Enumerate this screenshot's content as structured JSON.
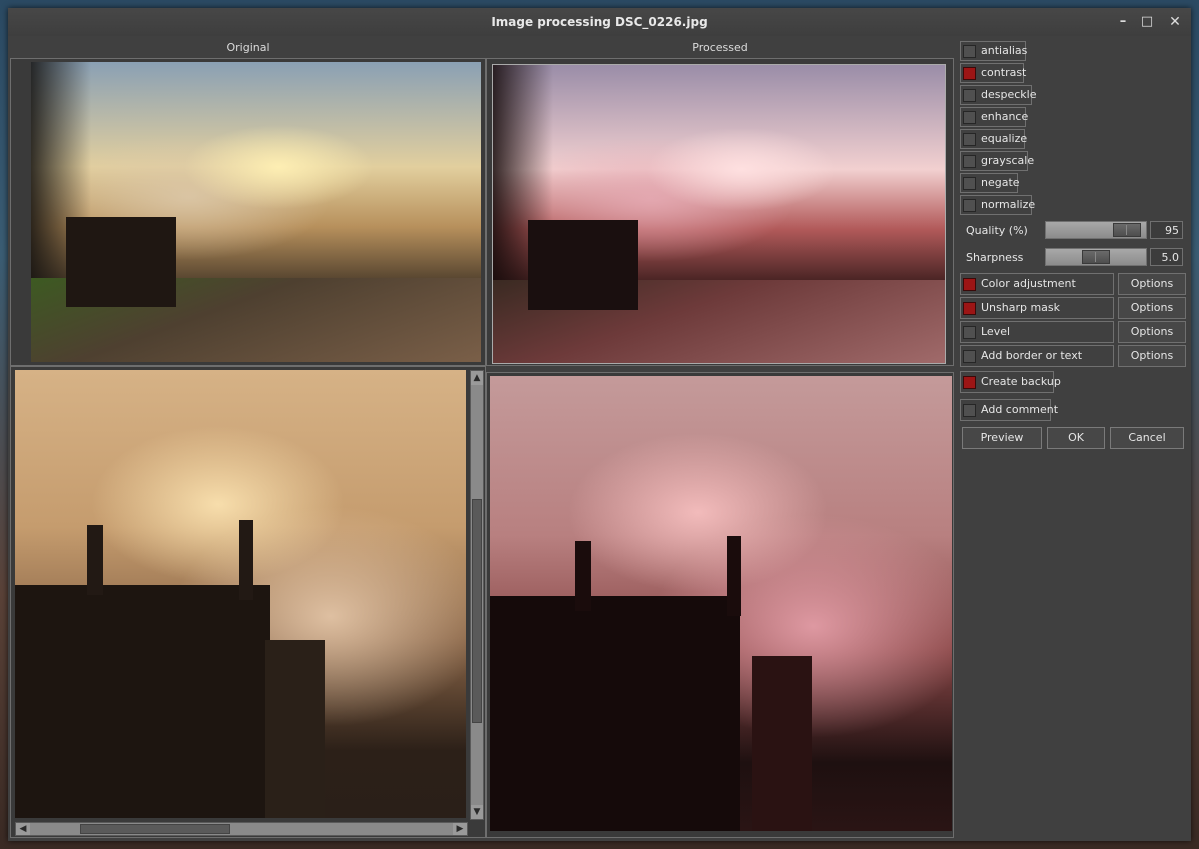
{
  "window": {
    "title": "Image processing DSC_0226.jpg"
  },
  "panels": {
    "original_label": "Original",
    "processed_label": "Processed"
  },
  "options": [
    {
      "label": "antialias",
      "checked": false
    },
    {
      "label": "contrast",
      "checked": true
    },
    {
      "label": "despeckle",
      "checked": false
    },
    {
      "label": "enhance",
      "checked": false
    },
    {
      "label": "equalize",
      "checked": false
    },
    {
      "label": "grayscale",
      "checked": false
    },
    {
      "label": "negate",
      "checked": false
    },
    {
      "label": "normalize",
      "checked": false
    }
  ],
  "quality": {
    "label": "Quality (%)",
    "value": "95"
  },
  "sharpness": {
    "label": "Sharpness",
    "value": "5.0"
  },
  "filters": [
    {
      "label": "Color adjustment",
      "checked": true,
      "options_label": "Options"
    },
    {
      "label": "Unsharp mask",
      "checked": true,
      "options_label": "Options"
    },
    {
      "label": "Level",
      "checked": false,
      "options_label": "Options"
    },
    {
      "label": "Add border or text",
      "checked": false,
      "options_label": "Options"
    }
  ],
  "create_backup": {
    "label": "Create backup",
    "checked": true
  },
  "add_comment": {
    "label": "Add comment",
    "checked": false
  },
  "buttons": {
    "preview": "Preview",
    "ok": "OK",
    "cancel": "Cancel"
  },
  "icons": {
    "minimize": "minimize-icon",
    "maximize": "maximize-icon",
    "close": "close-icon",
    "arrow_up": "arrow-up-icon",
    "arrow_down": "arrow-down-icon",
    "arrow_left": "arrow-left-icon",
    "arrow_right": "arrow-right-icon"
  },
  "colors": {
    "checked": "#9c1515",
    "window_bg": "#404040"
  }
}
